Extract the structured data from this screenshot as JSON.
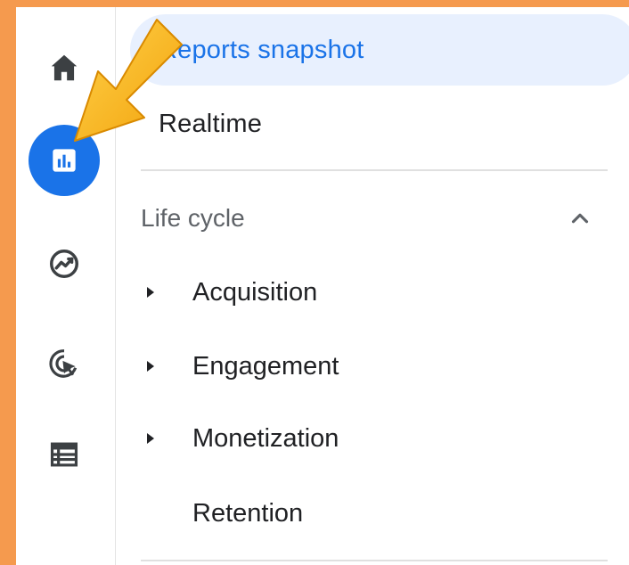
{
  "colors": {
    "frame": "#f59a4e",
    "accent_blue": "#1a73e8",
    "active_bg": "#e8f0fe",
    "arrow": "#f7b01a"
  },
  "rail": {
    "icons": [
      "home-icon",
      "reports-bar-chart-icon",
      "explore-trend-icon",
      "advertising-cursor-icon",
      "list-icon"
    ],
    "active_index": 1
  },
  "nav": {
    "reports_snapshot": "Reports snapshot",
    "realtime": "Realtime",
    "section": {
      "label": "Life cycle",
      "items": [
        {
          "label": "Acquisition",
          "expandable": true
        },
        {
          "label": "Engagement",
          "expandable": true
        },
        {
          "label": "Monetization",
          "expandable": true
        },
        {
          "label": "Retention",
          "expandable": false
        }
      ]
    }
  }
}
